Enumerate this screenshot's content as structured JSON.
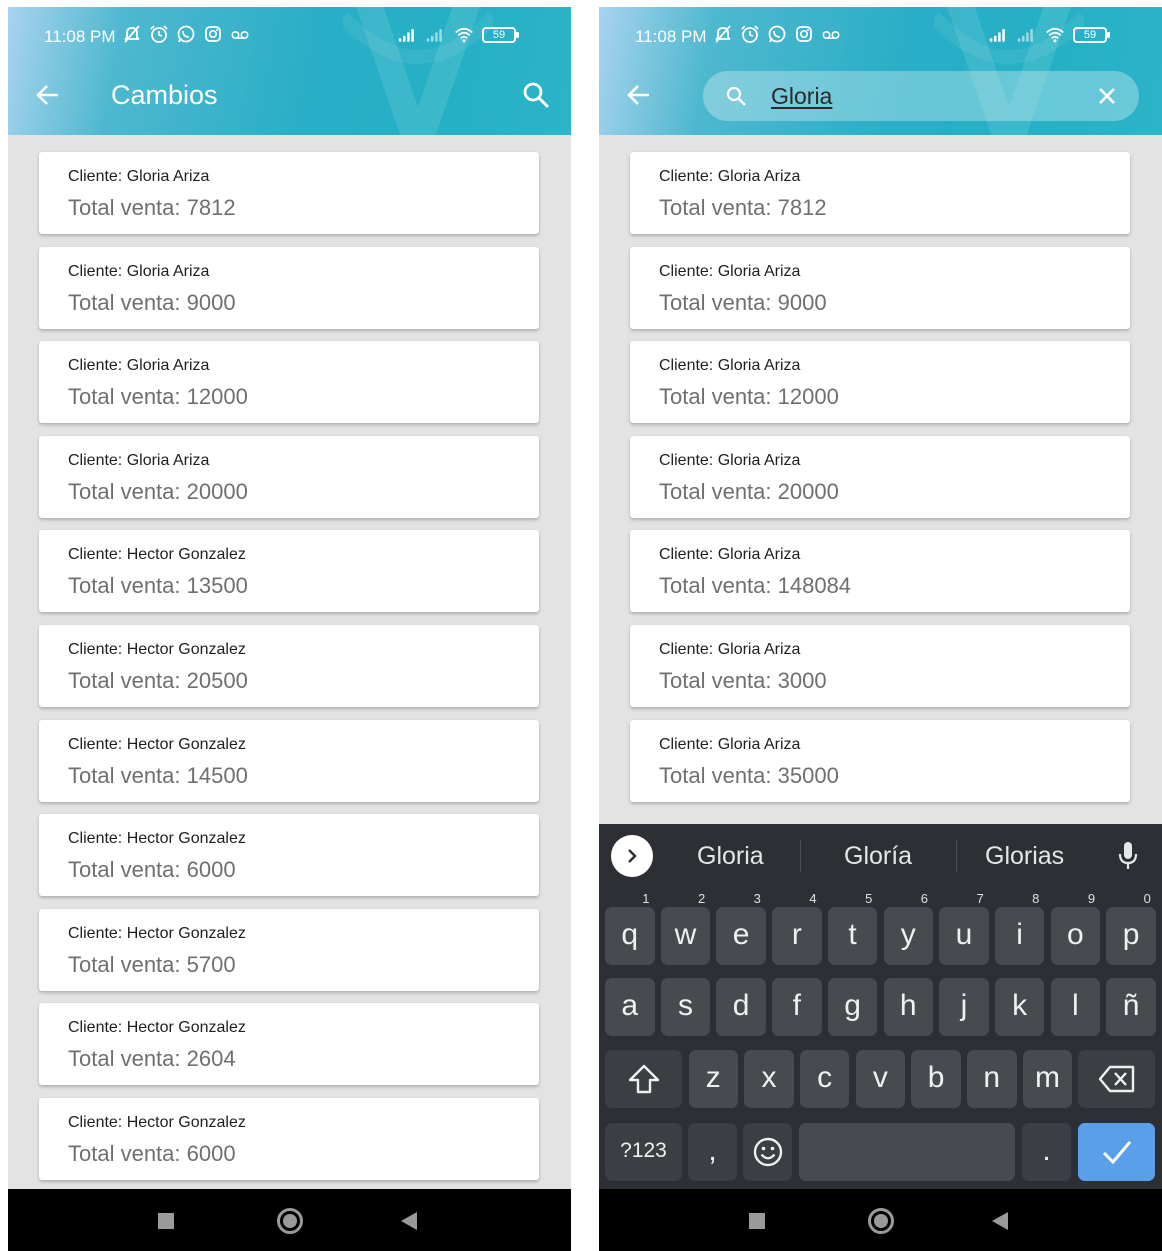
{
  "status_bar": {
    "time": "11:08 PM",
    "battery": "59"
  },
  "left_screen": {
    "title": "Cambios",
    "items": [
      {
        "cliente": "Cliente: Gloria Ariza",
        "total": "Total venta: 7812"
      },
      {
        "cliente": "Cliente: Gloria Ariza",
        "total": "Total venta: 9000"
      },
      {
        "cliente": "Cliente: Gloria Ariza",
        "total": "Total venta: 12000"
      },
      {
        "cliente": "Cliente: Gloria Ariza",
        "total": "Total venta: 20000"
      },
      {
        "cliente": "Cliente: Hector Gonzalez",
        "total": "Total venta: 13500"
      },
      {
        "cliente": "Cliente: Hector Gonzalez",
        "total": "Total venta: 20500"
      },
      {
        "cliente": "Cliente: Hector Gonzalez",
        "total": "Total venta: 14500"
      },
      {
        "cliente": "Cliente: Hector Gonzalez",
        "total": "Total venta: 6000"
      },
      {
        "cliente": "Cliente: Hector Gonzalez",
        "total": "Total venta: 5700"
      },
      {
        "cliente": "Cliente: Hector Gonzalez",
        "total": "Total venta: 2604"
      },
      {
        "cliente": "Cliente: Hector Gonzalez",
        "total": "Total venta: 6000"
      }
    ]
  },
  "right_screen": {
    "search_query": "Gloria",
    "items": [
      {
        "cliente": "Cliente: Gloria Ariza",
        "total": "Total venta: 7812"
      },
      {
        "cliente": "Cliente: Gloria Ariza",
        "total": "Total venta: 9000"
      },
      {
        "cliente": "Cliente: Gloria Ariza",
        "total": "Total venta: 12000"
      },
      {
        "cliente": "Cliente: Gloria Ariza",
        "total": "Total venta: 20000"
      },
      {
        "cliente": "Cliente: Gloria Ariza",
        "total": "Total venta: 148084"
      },
      {
        "cliente": "Cliente: Gloria Ariza",
        "total": "Total venta: 3000"
      },
      {
        "cliente": "Cliente: Gloria Ariza",
        "total": "Total venta: 35000"
      }
    ]
  },
  "keyboard": {
    "suggestions": [
      "Gloria",
      "Gloría",
      "Glorias"
    ],
    "row1": [
      {
        "key": "q",
        "hint": "1"
      },
      {
        "key": "w",
        "hint": "2"
      },
      {
        "key": "e",
        "hint": "3"
      },
      {
        "key": "r",
        "hint": "4"
      },
      {
        "key": "t",
        "hint": "5"
      },
      {
        "key": "y",
        "hint": "6"
      },
      {
        "key": "u",
        "hint": "7"
      },
      {
        "key": "i",
        "hint": "8"
      },
      {
        "key": "o",
        "hint": "9"
      },
      {
        "key": "p",
        "hint": "0"
      }
    ],
    "row2": [
      "a",
      "s",
      "d",
      "f",
      "g",
      "h",
      "j",
      "k",
      "l",
      "ñ"
    ],
    "row3": [
      "z",
      "x",
      "c",
      "v",
      "b",
      "n",
      "m"
    ],
    "symbols_label": "?123",
    "comma": ",",
    "period": "."
  },
  "icons": {
    "back": "arrow-left-icon",
    "search": "search-icon",
    "clear": "close-icon",
    "mic": "microphone-icon",
    "shift": "shift-icon",
    "delete": "backspace-icon",
    "emoji": "emoji-icon",
    "enter": "checkmark-icon"
  },
  "colors": {
    "header_accent": "#28aec6",
    "enter_key": "#5aa0e8",
    "keyboard_bg": "#2c2f33"
  }
}
